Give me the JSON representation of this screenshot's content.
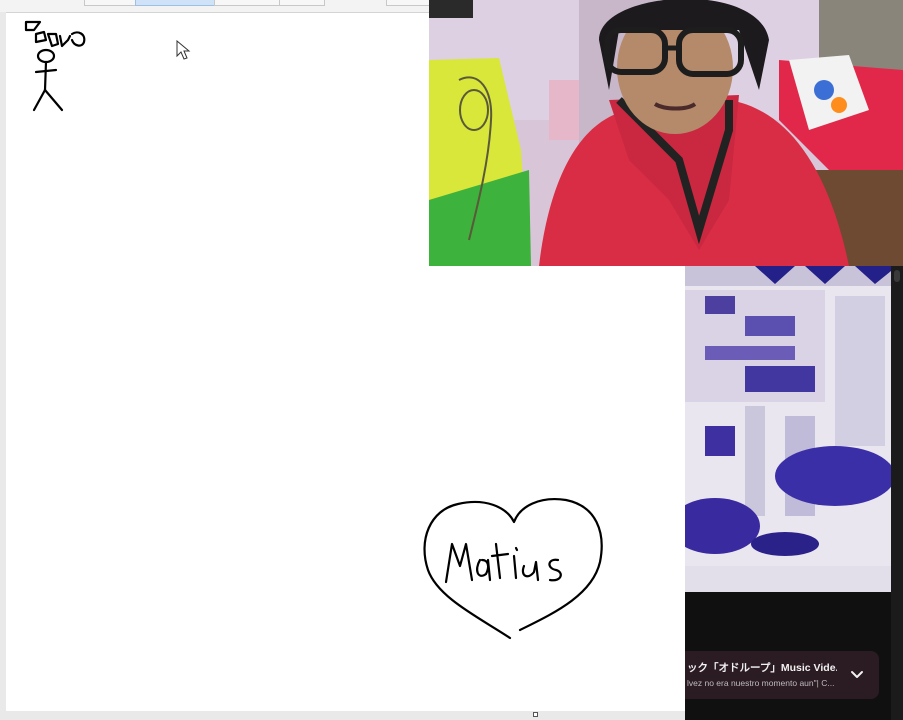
{
  "canvas": {
    "doodles": [
      {
        "name": "stick-figure-doodle"
      },
      {
        "name": "heart-doodle"
      }
    ]
  },
  "video": {
    "title": "ック「オドループ」Music Vide...",
    "subtitle": "lvez no era nuestro momento aun\"| C...",
    "expand_icon": "chevron-down-icon"
  },
  "colors": {
    "canvas_bg": "#ffffff",
    "panel_bg": "#101010",
    "video_card_bg": "#2b1b22"
  }
}
